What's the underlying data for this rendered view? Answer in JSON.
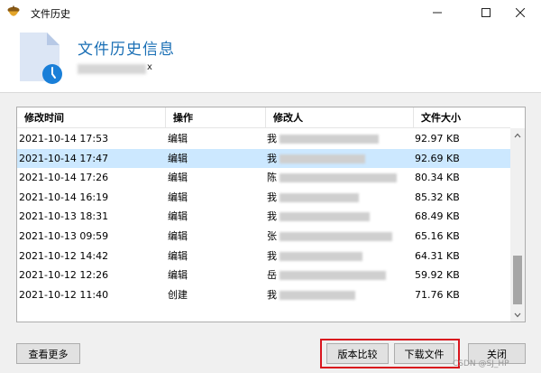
{
  "window": {
    "title": "文件历史",
    "icon": "acorn-icon"
  },
  "header": {
    "title": "文件历史信息",
    "subtitle_visible_tail": "x"
  },
  "table": {
    "columns": [
      "修改时间",
      "操作",
      "修改人",
      "文件大小"
    ],
    "rows": [
      {
        "time": "2021-10-14 17:53",
        "action": "编辑",
        "user": "我",
        "size": "92.97 KB",
        "selected": false
      },
      {
        "time": "2021-10-14 17:47",
        "action": "编辑",
        "user": "我",
        "size": "92.69 KB",
        "selected": true
      },
      {
        "time": "2021-10-14 17:26",
        "action": "编辑",
        "user": "陈",
        "size": "80.34 KB",
        "selected": false
      },
      {
        "time": "2021-10-14 16:19",
        "action": "编辑",
        "user": "我",
        "size": "85.32 KB",
        "selected": false
      },
      {
        "time": "2021-10-13 18:31",
        "action": "编辑",
        "user": "我",
        "size": "68.49 KB",
        "selected": false
      },
      {
        "time": "2021-10-13 09:59",
        "action": "编辑",
        "user": "张",
        "size": "65.16 KB",
        "selected": false
      },
      {
        "time": "2021-10-12 14:42",
        "action": "编辑",
        "user": "我",
        "size": "64.31 KB",
        "selected": false
      },
      {
        "time": "2021-10-12 12:26",
        "action": "编辑",
        "user": "岳",
        "size": "59.92 KB",
        "selected": false
      },
      {
        "time": "2021-10-12 11:40",
        "action": "创建",
        "user": "我",
        "size": "71.76 KB",
        "selected": false
      }
    ]
  },
  "buttons": {
    "more": "查看更多",
    "compare": "版本比较",
    "download": "下载文件",
    "close": "关闭"
  },
  "watermark": "CSDN @SJ_HP",
  "colors": {
    "title_blue": "#1a6fb5",
    "selection": "#cce8ff",
    "highlight_red": "#d9151e"
  }
}
